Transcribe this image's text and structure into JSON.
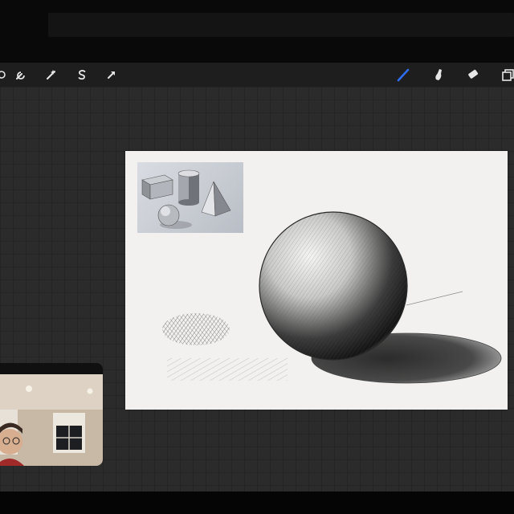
{
  "toolbar": {
    "left_tools": [
      {
        "icon": "actions-icon"
      },
      {
        "icon": "wrench-icon"
      },
      {
        "icon": "adjustments-wand-icon"
      },
      {
        "icon": "selection-s-icon"
      },
      {
        "icon": "transform-arrow-icon"
      }
    ],
    "right_tools": [
      {
        "icon": "brush-icon",
        "active": true
      },
      {
        "icon": "smudge-icon"
      },
      {
        "icon": "eraser-icon"
      },
      {
        "icon": "layers-icon"
      }
    ],
    "active_color": "#2f6df6"
  },
  "canvas": {
    "background": "#f2f1ef",
    "reference_image": {
      "icon": "reference-still-life-image"
    },
    "drawing": {
      "icon": "shaded-sphere-sketch"
    }
  },
  "video_call": {
    "icon": "participant-video-feed"
  }
}
